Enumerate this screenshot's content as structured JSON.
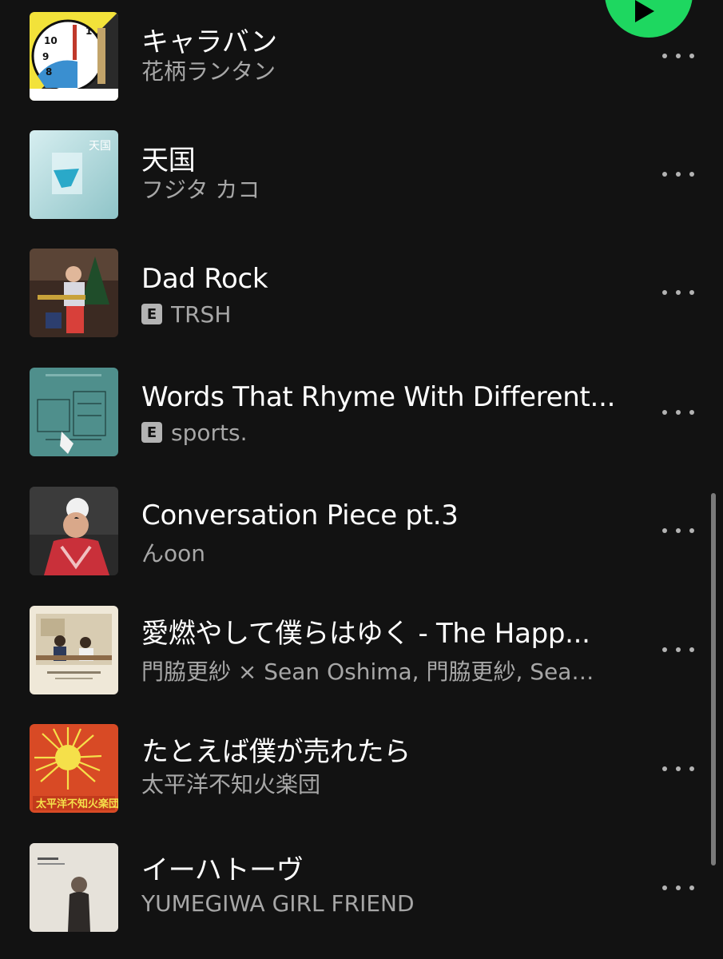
{
  "play_button": {
    "icon": "play-icon",
    "color": "#1ed760"
  },
  "tracks": [
    {
      "title": "キャラバン",
      "artist": "花柄ランタン",
      "explicit": false,
      "more_icon": "more-options-icon"
    },
    {
      "title": "天国",
      "artist": "フジタ カコ",
      "explicit": false,
      "more_icon": "more-options-icon"
    },
    {
      "title": "Dad Rock",
      "artist": "TRSH",
      "explicit": true,
      "explicit_label": "E",
      "more_icon": "more-options-icon"
    },
    {
      "title": "Words That Rhyme With Different...",
      "artist": "sports.",
      "explicit": true,
      "explicit_label": "E",
      "more_icon": "more-options-icon"
    },
    {
      "title": "Conversation Piece pt.3",
      "artist": "んoon",
      "explicit": false,
      "more_icon": "more-options-icon"
    },
    {
      "title": "愛燃やして僕らはゆく - The Happ...",
      "artist": "門脇更紗 × Sean Oshima, 門脇更紗, Sean...",
      "explicit": false,
      "more_icon": "more-options-icon"
    },
    {
      "title": "たとえば僕が売れたら",
      "artist": "太平洋不知火楽団",
      "explicit": false,
      "more_icon": "more-options-icon"
    },
    {
      "title": "イーハトーヴ",
      "artist": "YUMEGIWA GIRL FRIEND",
      "explicit": false,
      "more_icon": "more-options-icon"
    }
  ]
}
